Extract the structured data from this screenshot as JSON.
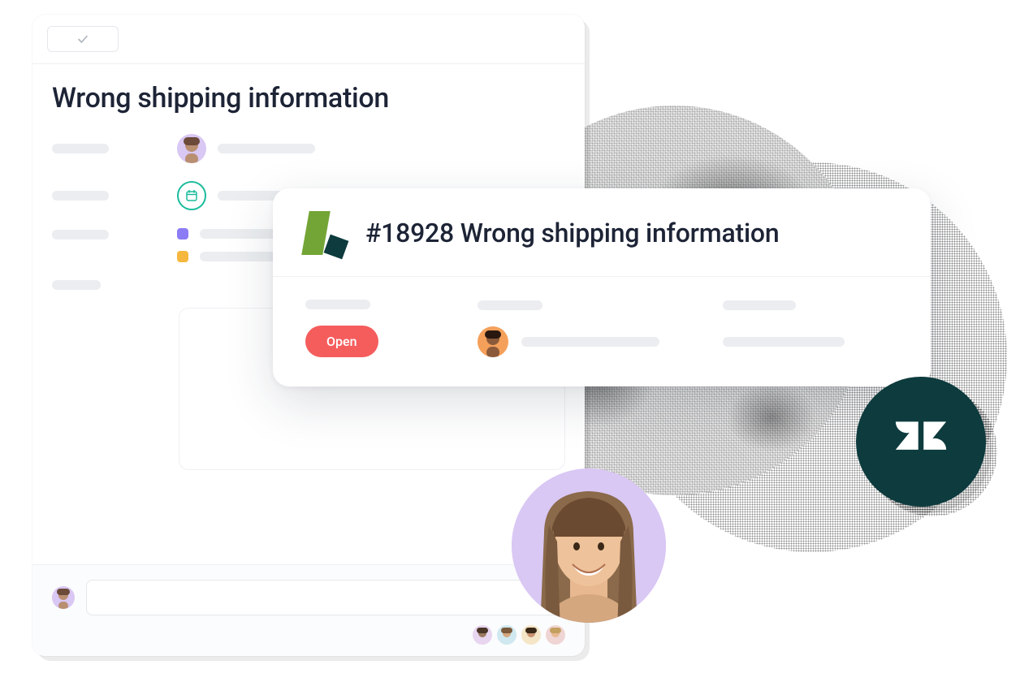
{
  "task": {
    "title": "Wrong shipping information",
    "icons": {
      "complete": "check-icon",
      "dueDate": "calendar-icon"
    }
  },
  "ticket": {
    "id": "#18928",
    "title": "Wrong shipping information",
    "fullTitle": "#18928 Wrong shipping information",
    "status": "Open",
    "brandIcon": "zendesk-brand-icon"
  },
  "integration": {
    "name": "zendesk",
    "icon": "zendesk-logo-icon"
  },
  "colors": {
    "status_open": "#f55d5d",
    "accent_green": "#1abc9c",
    "zendesk_dark": "#0d3b3e",
    "brand_green": "#73a536",
    "tag_purple": "#8b7cf6",
    "tag_yellow": "#f5b73d"
  }
}
